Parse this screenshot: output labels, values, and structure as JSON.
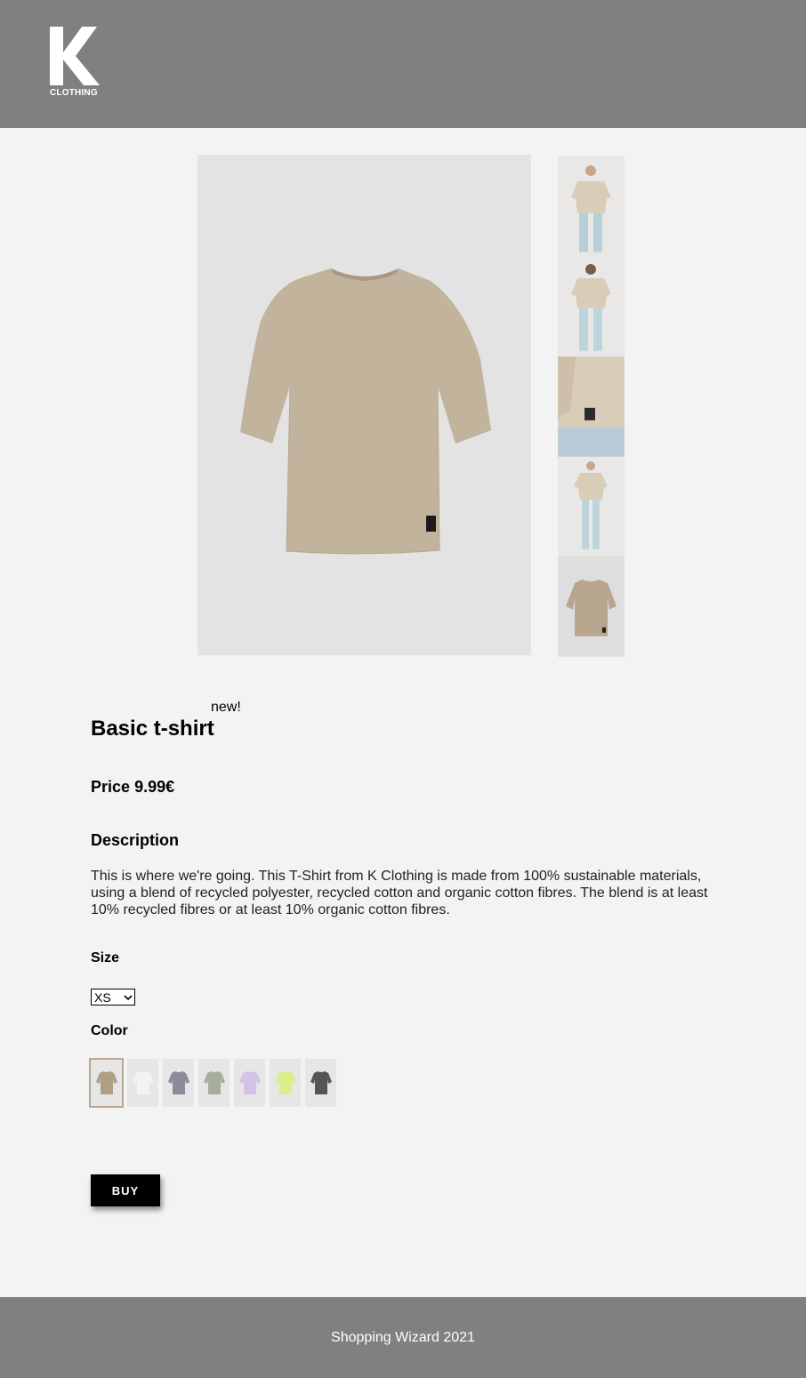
{
  "header": {
    "logo_letter": "K",
    "logo_text": "CLOTHING",
    "background_color": "#808080"
  },
  "gallery": {
    "main_image": "beige-tshirt-flatlay",
    "thumbnails": [
      "model-front-view",
      "model-back-view",
      "sleeve-detail-view",
      "model-full-view",
      "tshirt-flatlay"
    ]
  },
  "product": {
    "badge": "new!",
    "title": "Basic t-shirt",
    "price_label": "Price",
    "price_value": "9.99€",
    "description_heading": "Description",
    "description": "This is where we're going. This T-Shirt from K Clothing  is made from 100% sustainable materials, using a blend of recycled polyester, recycled cotton and organic cotton fibres. The blend is at least 10% recycled fibres or at least 10% organic cotton fibres.",
    "size_heading": "Size",
    "size_selected": "XS",
    "color_heading": "Color",
    "colors": [
      {
        "name": "beige",
        "hex": "#b19e87",
        "selected": true
      },
      {
        "name": "white",
        "hex": "#f1f1f1",
        "selected": false
      },
      {
        "name": "grey-lilac",
        "hex": "#8d8a99",
        "selected": false
      },
      {
        "name": "sage",
        "hex": "#a6ad98",
        "selected": false
      },
      {
        "name": "lavender",
        "hex": "#d3c3e6",
        "selected": false
      },
      {
        "name": "lime",
        "hex": "#d9ef8a",
        "selected": false
      },
      {
        "name": "charcoal",
        "hex": "#555555",
        "selected": false
      }
    ],
    "buy_label": "BUY"
  },
  "footer": {
    "text": "Shopping Wizard 2021"
  }
}
